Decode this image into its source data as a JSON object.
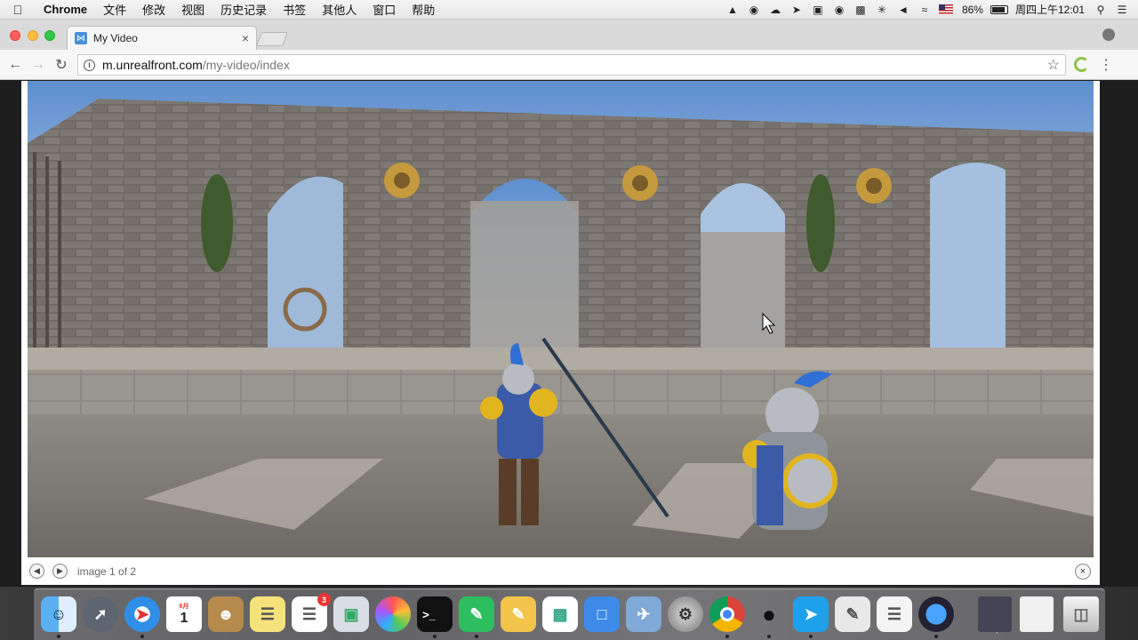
{
  "menubar": {
    "app_name": "Chrome",
    "items": [
      "文件",
      "修改",
      "视图",
      "历史记录",
      "书签",
      "其他人",
      "窗口",
      "帮助"
    ],
    "battery": "86%",
    "battery_level": 0.86,
    "clock": "周四上午12:01"
  },
  "browser": {
    "tab_title": "My Video",
    "url_host": "m.unrealfront.com",
    "url_path": "/my-video/index"
  },
  "viewer": {
    "caption": "image 1 of 2"
  },
  "dock": {
    "calendar_month": "6月",
    "calendar_day": "1",
    "reminders_badge": "3"
  }
}
